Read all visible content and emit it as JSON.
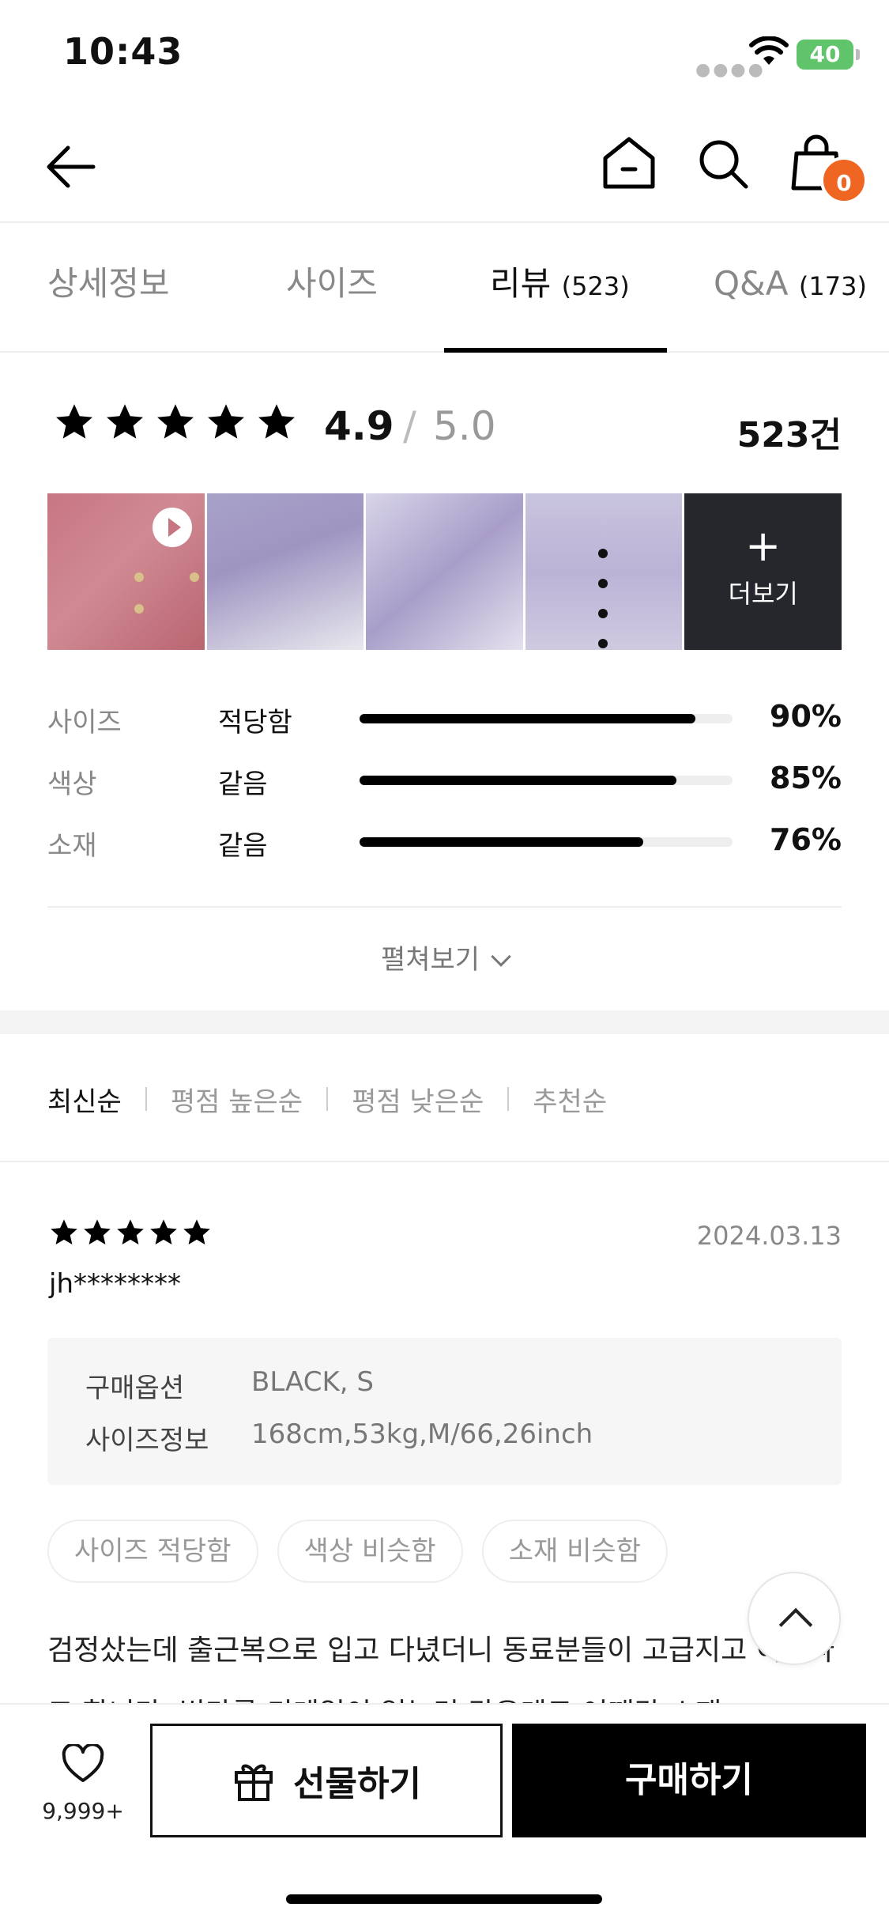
{
  "status_bar": {
    "time": "10:43",
    "battery": "40"
  },
  "top_nav": {
    "cart_count": "0"
  },
  "tabs": [
    {
      "label": "상세정보",
      "count": ""
    },
    {
      "label": "사이즈",
      "count": ""
    },
    {
      "label": "리뷰",
      "count": "(523)"
    },
    {
      "label": "Q&A",
      "count": "(173)"
    }
  ],
  "rating": {
    "score": "4.9",
    "separator": "/",
    "max": "5.0",
    "total": "523건",
    "stars": 5
  },
  "photos": {
    "more_label": "더보기"
  },
  "fit_stats": [
    {
      "name": "사이즈",
      "value": "적당함",
      "percent_text": "90%",
      "percent": 90
    },
    {
      "name": "색상",
      "value": "같음",
      "percent_text": "85%",
      "percent": 85
    },
    {
      "name": "소재",
      "value": "같음",
      "percent_text": "76%",
      "percent": 76
    }
  ],
  "expand_label": "펼쳐보기",
  "sort": [
    "최신순",
    "평점 높은순",
    "평점 낮은순",
    "추천순"
  ],
  "review": {
    "stars": 5,
    "date": "2024.03.13",
    "user": "jh********",
    "option_label": "구매옵션",
    "option_value": "BLACK, S",
    "size_label": "사이즈정보",
    "size_value": "168cm,53kg,M/66,26inch",
    "chips": [
      "사이즈 적당함",
      "색상 비슷함",
      "소재 비슷함"
    ],
    "text": "검정샀는데 출근복으로 입고 다녔더니 동료분들이 고급지고 이쁘다고 합니다. 별다른 디테일이 없는것 같은데도 어깨각 소재"
  },
  "bottom_bar": {
    "like_count": "9,999+",
    "gift_label": "선물하기",
    "buy_label": "구매하기"
  },
  "colors": {
    "accent": "#ef6522",
    "battery": "#5fc46a"
  }
}
